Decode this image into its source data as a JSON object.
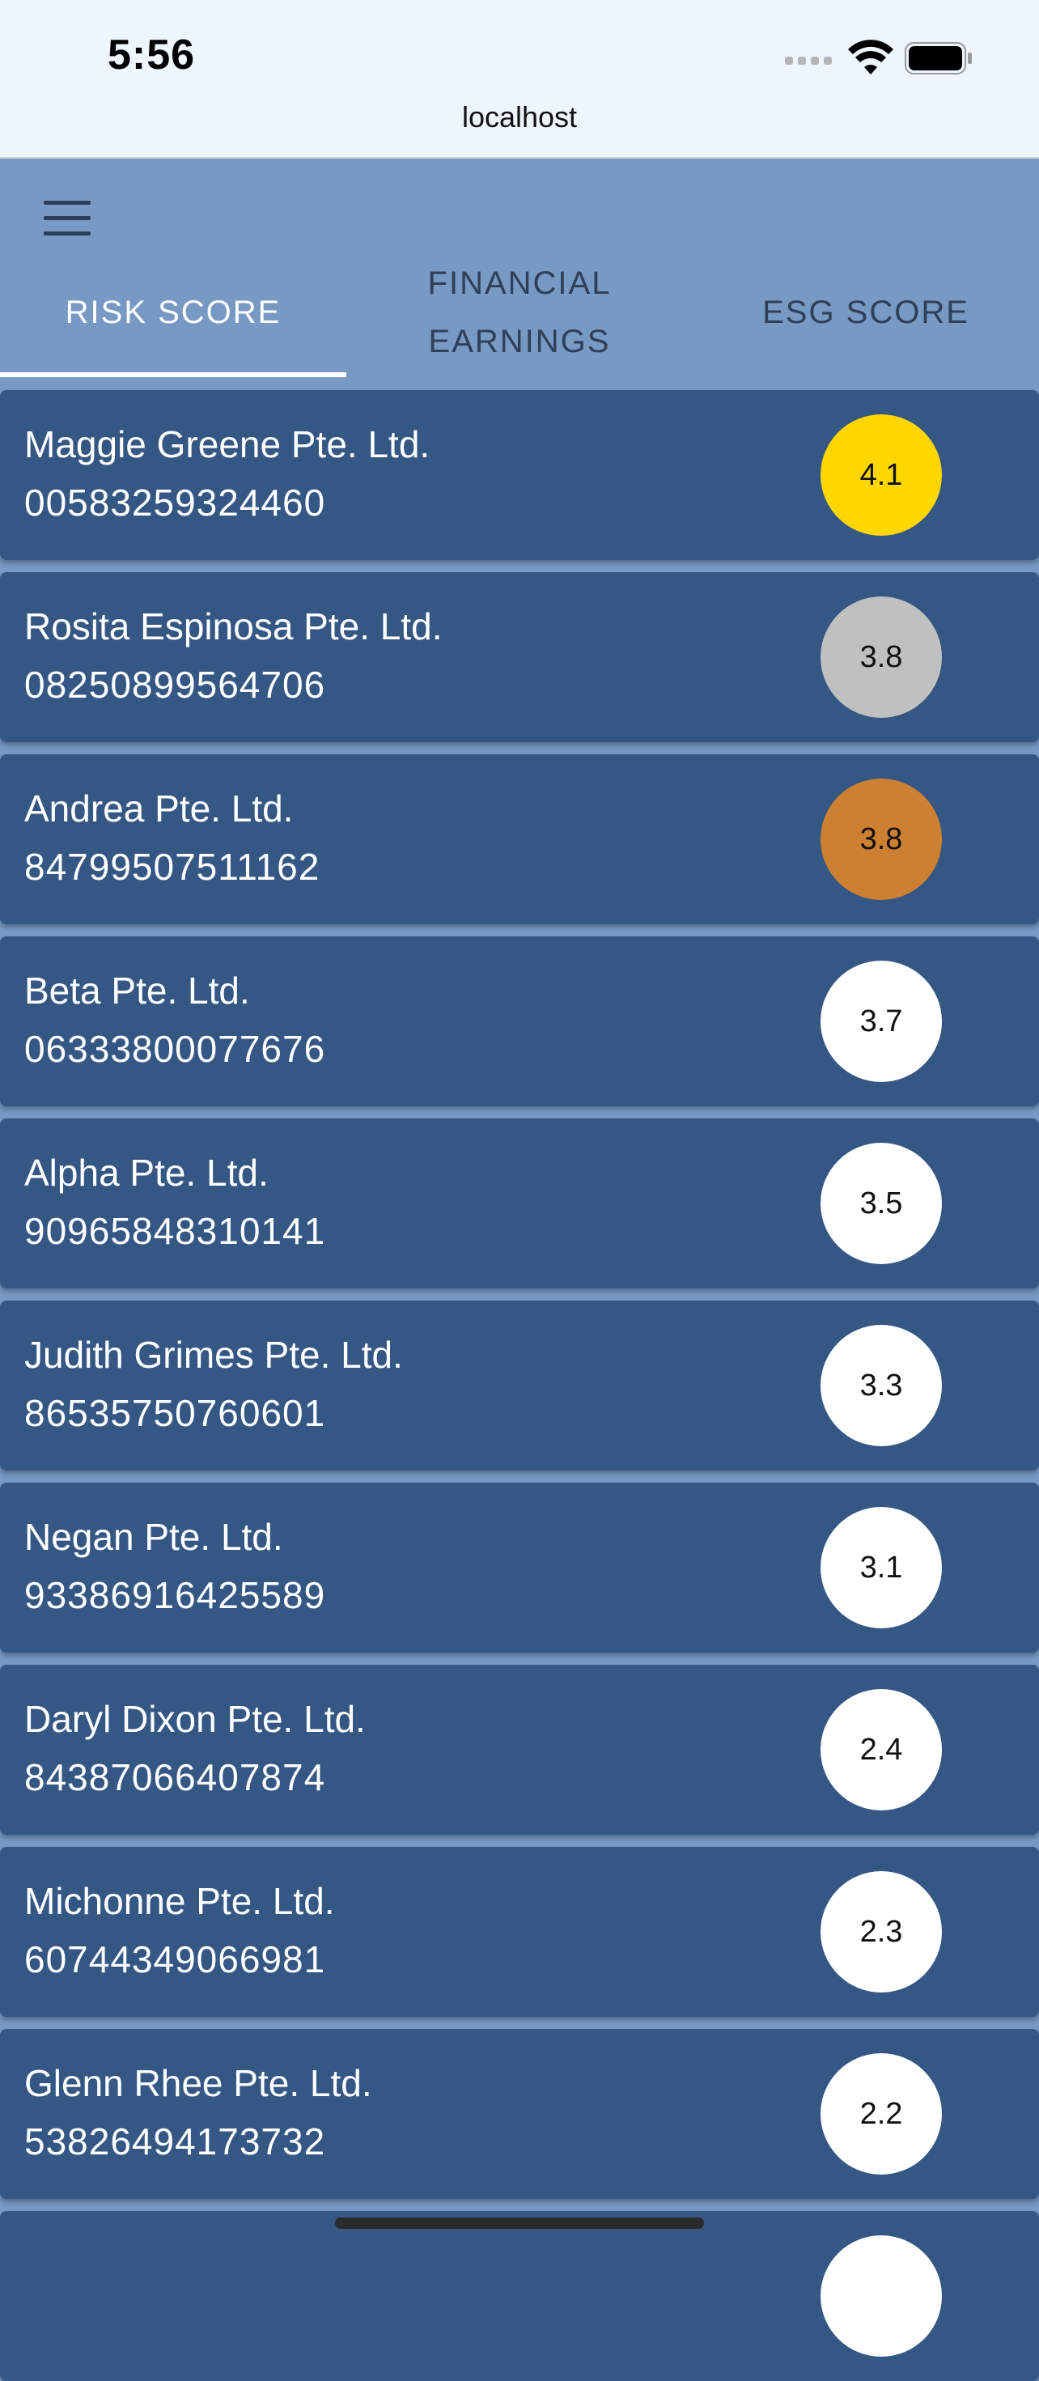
{
  "status_bar": {
    "time": "5:56",
    "url": "localhost"
  },
  "header": {
    "menu_icon": "hamburger-menu-icon",
    "tabs": [
      {
        "label_line1": "RISK SCORE",
        "label_line2": "",
        "active": true
      },
      {
        "label_line1": "FINANCIAL",
        "label_line2": "EARNINGS",
        "active": false
      },
      {
        "label_line1": "ESG SCORE",
        "label_line2": "",
        "active": false
      }
    ]
  },
  "colors": {
    "gold": "#ffd700",
    "silver": "#c0c0c0",
    "bronze": "#cd7f32",
    "default": "#ffffff",
    "card": "#355784",
    "header": "#7899c4"
  },
  "companies": [
    {
      "name": "Maggie Greene Pte. Ltd.",
      "id": "00583259324460",
      "score": "4.1",
      "badge_color": "#ffd700"
    },
    {
      "name": "Rosita Espinosa Pte. Ltd.",
      "id": "08250899564706",
      "score": "3.8",
      "badge_color": "#c0c0c0"
    },
    {
      "name": "Andrea Pte. Ltd.",
      "id": "84799507511162",
      "score": "3.8",
      "badge_color": "#cd7f32"
    },
    {
      "name": "Beta Pte. Ltd.",
      "id": "06333800077676",
      "score": "3.7",
      "badge_color": "#ffffff"
    },
    {
      "name": "Alpha Pte. Ltd.",
      "id": "90965848310141",
      "score": "3.5",
      "badge_color": "#ffffff"
    },
    {
      "name": "Judith Grimes Pte. Ltd.",
      "id": "86535750760601",
      "score": "3.3",
      "badge_color": "#ffffff"
    },
    {
      "name": "Negan Pte. Ltd.",
      "id": "93386916425589",
      "score": "3.1",
      "badge_color": "#ffffff"
    },
    {
      "name": "Daryl Dixon Pte. Ltd.",
      "id": "84387066407874",
      "score": "2.4",
      "badge_color": "#ffffff"
    },
    {
      "name": "Michonne Pte. Ltd.",
      "id": "60744349066981",
      "score": "2.3",
      "badge_color": "#ffffff"
    },
    {
      "name": "Glenn Rhee Pte. Ltd.",
      "id": "53826494173732",
      "score": "2.2",
      "badge_color": "#ffffff"
    },
    {
      "name": "",
      "id": "",
      "score": "",
      "badge_color": "#ffffff"
    }
  ]
}
